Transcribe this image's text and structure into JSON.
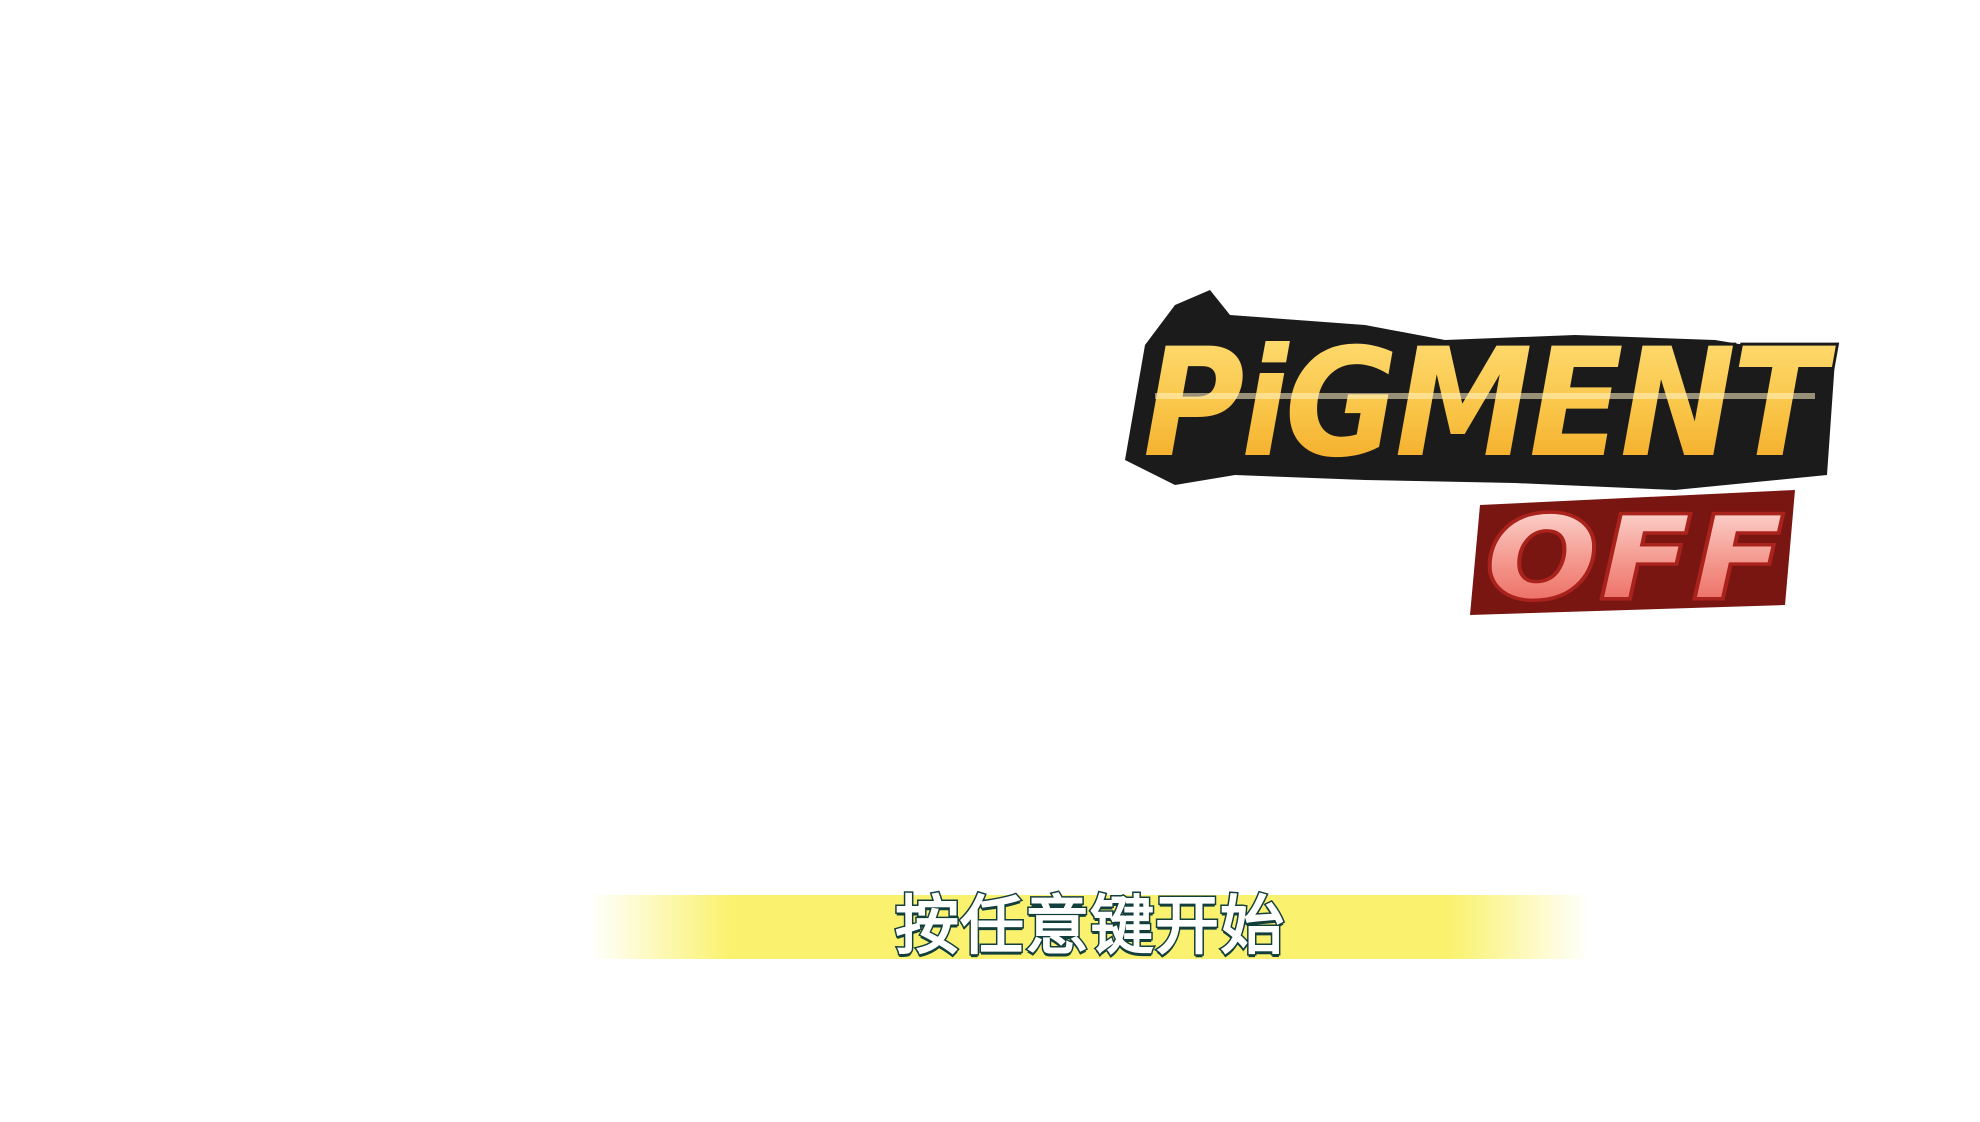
{
  "title_screen": {
    "logo": {
      "line1": "PiGMENT",
      "line2": "OFF",
      "colors": {
        "line1_fill_top": "#ffe07a",
        "line1_fill_bottom": "#f3a21d",
        "line1_outline": "#1b1b1b",
        "line2_fill_top": "#fbd2cb",
        "line2_fill_bottom": "#ea5a50",
        "line2_outline": "#a9221c"
      }
    },
    "prompt": {
      "text": "按任意键开始",
      "band_color": "#faf26e",
      "text_outline_color": "#123e3c"
    }
  }
}
